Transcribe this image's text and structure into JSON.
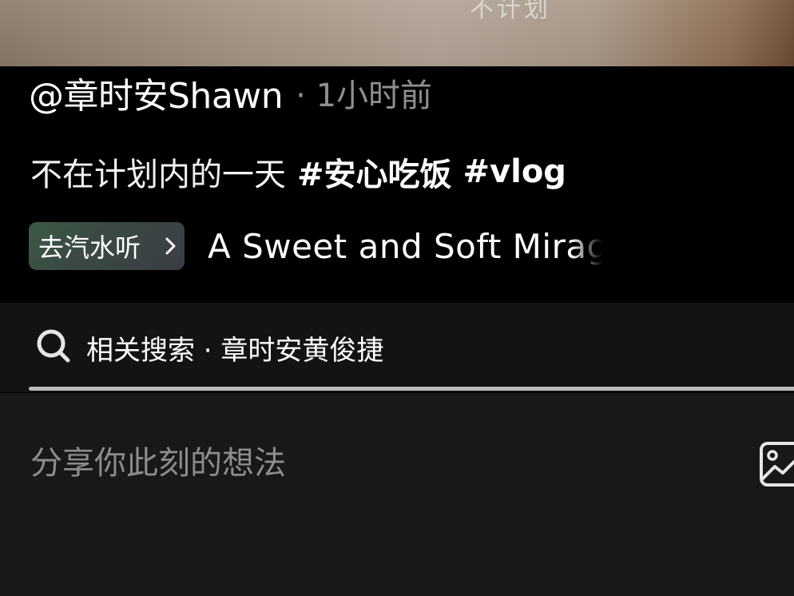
{
  "video": {
    "caption_partial": "不计划"
  },
  "post": {
    "author": "@章时安Shawn",
    "time_label": "· 1小时前",
    "caption": "不在计划内的一天",
    "hashtags": [
      "#安心吃饭",
      "#vlog"
    ]
  },
  "music": {
    "badge_label": "去汽水听",
    "badge_icon": "chevron-right-icon",
    "song_title": "A Sweet and Soft Mirage"
  },
  "related_search": {
    "icon": "search-icon",
    "label": "相关搜索 · 章时安黄俊捷"
  },
  "comment_input": {
    "placeholder": "分享你此刻的想法",
    "image_icon": "image-icon"
  },
  "colors": {
    "background": "#000000",
    "search_bar_bg": "#131313",
    "comment_bg": "#181818",
    "muted_text": "#8f8f8f",
    "badge_green": "#3c5a45"
  }
}
